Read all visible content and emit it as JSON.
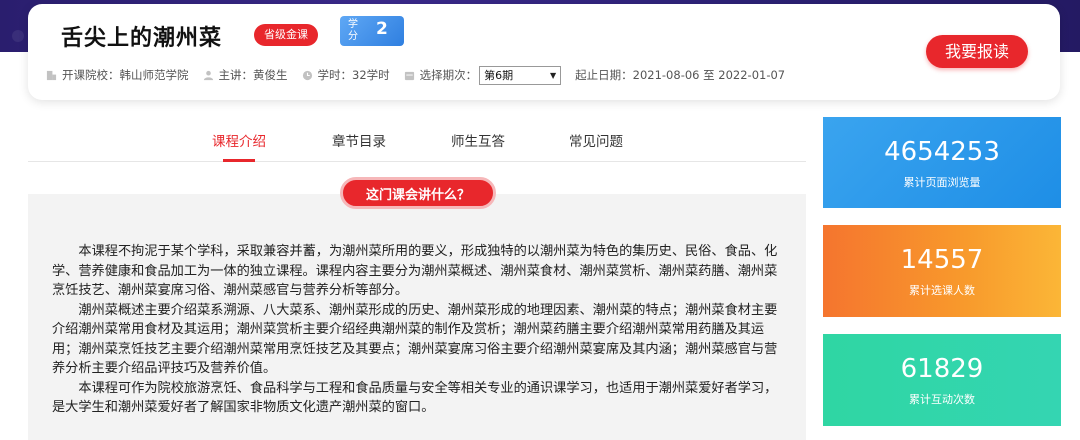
{
  "course": {
    "title": "舌尖上的潮州菜",
    "badge": "省级金课",
    "credit_label": "学分",
    "credit_value": "2",
    "enroll_button": "我要报读"
  },
  "meta": {
    "school": "开课院校：韩山师范学院",
    "teacher": "主讲：黄俊生",
    "hours": "学时：32学时",
    "period_label": "选择期次：",
    "period_selected": "第6期",
    "dates": "起止日期：2021-08-06 至 2022-01-07"
  },
  "tabs": [
    {
      "label": "课程介绍",
      "active": true
    },
    {
      "label": "章节目录",
      "active": false
    },
    {
      "label": "师生互答",
      "active": false
    },
    {
      "label": "常见问题",
      "active": false
    }
  ],
  "section": {
    "heading": "这门课会讲什么？",
    "paragraphs": [
      "本课程不拘泥于某个学科，采取兼容并蓄，为潮州菜所用的要义，形成独特的以潮州菜为特色的集历史、民俗、食品、化学、营养健康和食品加工为一体的独立课程。课程内容主要分为潮州菜概述、潮州菜食材、潮州菜赏析、潮州菜药膳、潮州菜烹饪技艺、潮州菜宴席习俗、潮州菜感官与营养分析等部分。",
      "潮州菜概述主要介绍菜系溯源、八大菜系、潮州菜形成的历史、潮州菜形成的地理因素、潮州菜的特点；潮州菜食材主要介绍潮州菜常用食材及其运用；潮州菜赏析主要介绍经典潮州菜的制作及赏析；潮州菜药膳主要介绍潮州菜常用药膳及其运用；潮州菜烹饪技艺主要介绍潮州菜常用烹饪技艺及其要点；潮州菜宴席习俗主要介绍潮州菜宴席及其内涵；潮州菜感官与营养分析主要介绍品评技巧及营养价值。",
      "本课程可作为院校旅游烹饪、食品科学与工程和食品质量与安全等相关专业的通识课学习，也适用于潮州菜爱好者学习，是大学生和潮州菜爱好者了解国家非物质文化遗产潮州菜的窗口。"
    ]
  },
  "stats": [
    {
      "value": "4654253",
      "label": "累计页面浏览量",
      "color": "#2a98ea"
    },
    {
      "value": "14557",
      "label": "累计选课人数",
      "color": "#f7872d"
    },
    {
      "value": "61829",
      "label": "累计互动次数",
      "color": "#31d5aa"
    }
  ],
  "colors": {
    "accent": "#e8272c",
    "header_bg": "#2c2175"
  }
}
